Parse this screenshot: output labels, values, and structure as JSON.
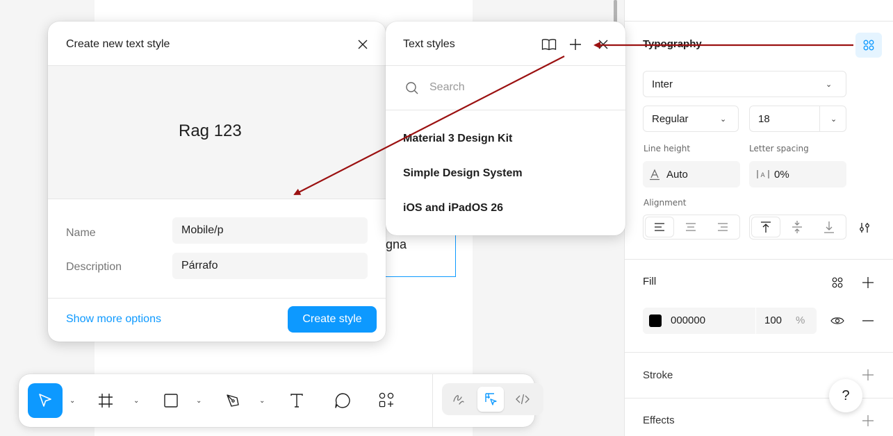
{
  "create_dialog": {
    "title": "Create new text style",
    "preview_text": "Rag 123",
    "name_label": "Name",
    "name_value": "Mobile/p",
    "description_label": "Description",
    "description_value": "Párrafo",
    "show_more": "Show more options",
    "create_button": "Create style"
  },
  "styles_panel": {
    "title": "Text styles",
    "search_placeholder": "Search",
    "libraries": [
      "Material 3 Design Kit",
      "Simple Design System",
      "iOS and iPadOS 26"
    ]
  },
  "canvas": {
    "text_fragment": "gna"
  },
  "typography": {
    "title": "Typography",
    "font_family": "Inter",
    "font_weight": "Regular",
    "font_size": "18",
    "line_height_label": "Line height",
    "line_height_value": "Auto",
    "letter_spacing_label": "Letter spacing",
    "letter_spacing_value": "0%",
    "alignment_label": "Alignment"
  },
  "fill": {
    "title": "Fill",
    "hex": "000000",
    "opacity": "100",
    "unit": "%",
    "color": "#000000"
  },
  "stroke": {
    "title": "Stroke"
  },
  "effects": {
    "title": "Effects"
  },
  "help": {
    "label": "?"
  },
  "colors": {
    "accent": "#0d99ff",
    "annotation_arrow": "#9b1111"
  }
}
